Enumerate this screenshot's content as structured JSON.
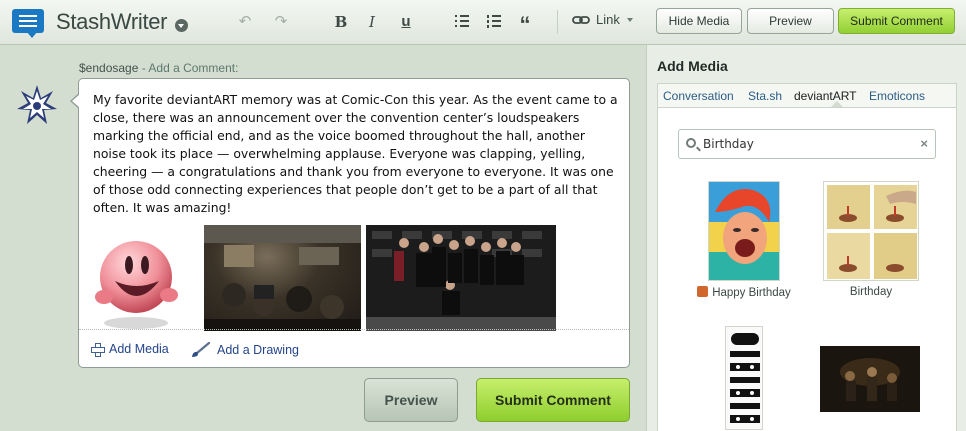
{
  "app": {
    "name": "StashWriter"
  },
  "toolbar": {
    "undo_icon": "undo-icon",
    "redo_icon": "redo-icon",
    "bold": "B",
    "italic": "I",
    "underline": "u",
    "quote": "“",
    "link_label": "Link",
    "hide_media": "Hide Media",
    "preview": "Preview",
    "submit": "Submit Comment"
  },
  "comment": {
    "username": "$endosage",
    "subtitle": "- Add a Comment:",
    "body": "My favorite deviantART memory was at Comic-Con this year. As the event came to a close, there was an announcement over the convention center’s loudspeakers marking the official end, and as the voice boomed throughout the hall, another noise took its place — overwhelming applause. Everyone was clapping, yelling, cheering — a congratulations and thank you from everyone to everyone. It was one of those odd connecting experiences that people don’t get to be a part of all that often. It was amazing!",
    "add_media": "Add Media",
    "add_drawing": "Add a Drawing",
    "preview": "Preview",
    "submit": "Submit Comment"
  },
  "panel": {
    "title": "Add Media",
    "tabs": [
      "Conversation",
      "Sta.sh",
      "deviantART",
      "Emoticons"
    ],
    "active_tab": "deviantART",
    "search_value": "Birthday",
    "results": [
      {
        "caption": "Happy Birthday"
      },
      {
        "caption": "Birthday"
      },
      {
        "caption": ""
      },
      {
        "caption": ""
      }
    ]
  },
  "colors": {
    "accent_green": "#a8df4b",
    "link_blue": "#24458a",
    "brand_blue": "#1b78c2"
  }
}
